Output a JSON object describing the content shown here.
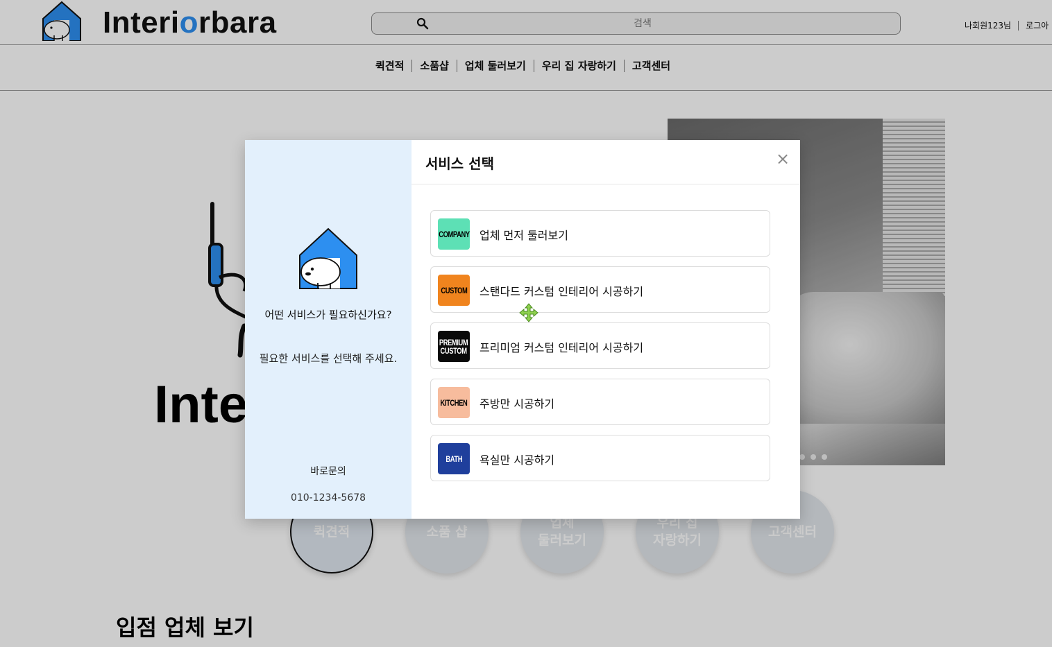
{
  "brand": {
    "name_prefix": "Interi",
    "name_o": "o",
    "name_suffix": "rbara",
    "accent": "#2d8ff0"
  },
  "search": {
    "placeholder": "검색",
    "icon": "search-icon"
  },
  "user": {
    "name": "나회원123님",
    "login": "로그아"
  },
  "nav": {
    "items": [
      "퀵견적",
      "소품샵",
      "업체 둘러보기",
      "우리 집 자랑하기",
      "고객센터"
    ]
  },
  "hero": {
    "text": "Inte"
  },
  "circles": [
    {
      "line1": "퀵견적",
      "line2": ""
    },
    {
      "line1": "소품 샵",
      "line2": ""
    },
    {
      "line1": "업체",
      "line2": "둘러보기"
    },
    {
      "line1": "우리 집",
      "line2": "자랑하기"
    },
    {
      "line1": "고객센터",
      "line2": ""
    }
  ],
  "section": {
    "title": "입점 업체 보기"
  },
  "modal": {
    "title": "서비스 선택",
    "close": "×",
    "question": "어떤 서비스가 필요하신가요?",
    "instruction": "필요한 서비스를 선택해 주세요.",
    "contact_label": "바로문의",
    "phone": "010-1234-5678",
    "options": [
      {
        "badge": "COMPANY",
        "badge_color": "#5de0b5",
        "badge_text_color": "#000000",
        "label": "업체 먼저 둘러보기"
      },
      {
        "badge": "CUSTOM",
        "badge_color": "#f0841e",
        "badge_text_color": "#000000",
        "label": "스탠다드 커스텀 인테리어 시공하기"
      },
      {
        "badge": "PREMIUM CUSTOM",
        "badge_color": "#0a0a0a",
        "badge_text_color": "#ffffff",
        "label": "프리미엄 커스텀 인테리어 시공하기"
      },
      {
        "badge": "KITCHEN",
        "badge_color": "#f7bc9d",
        "badge_text_color": "#000000",
        "label": "주방만 시공하기"
      },
      {
        "badge": "BATH",
        "badge_color": "#1f3f9c",
        "badge_text_color": "#ffffff",
        "label": "욕실만 시공하기"
      }
    ]
  }
}
